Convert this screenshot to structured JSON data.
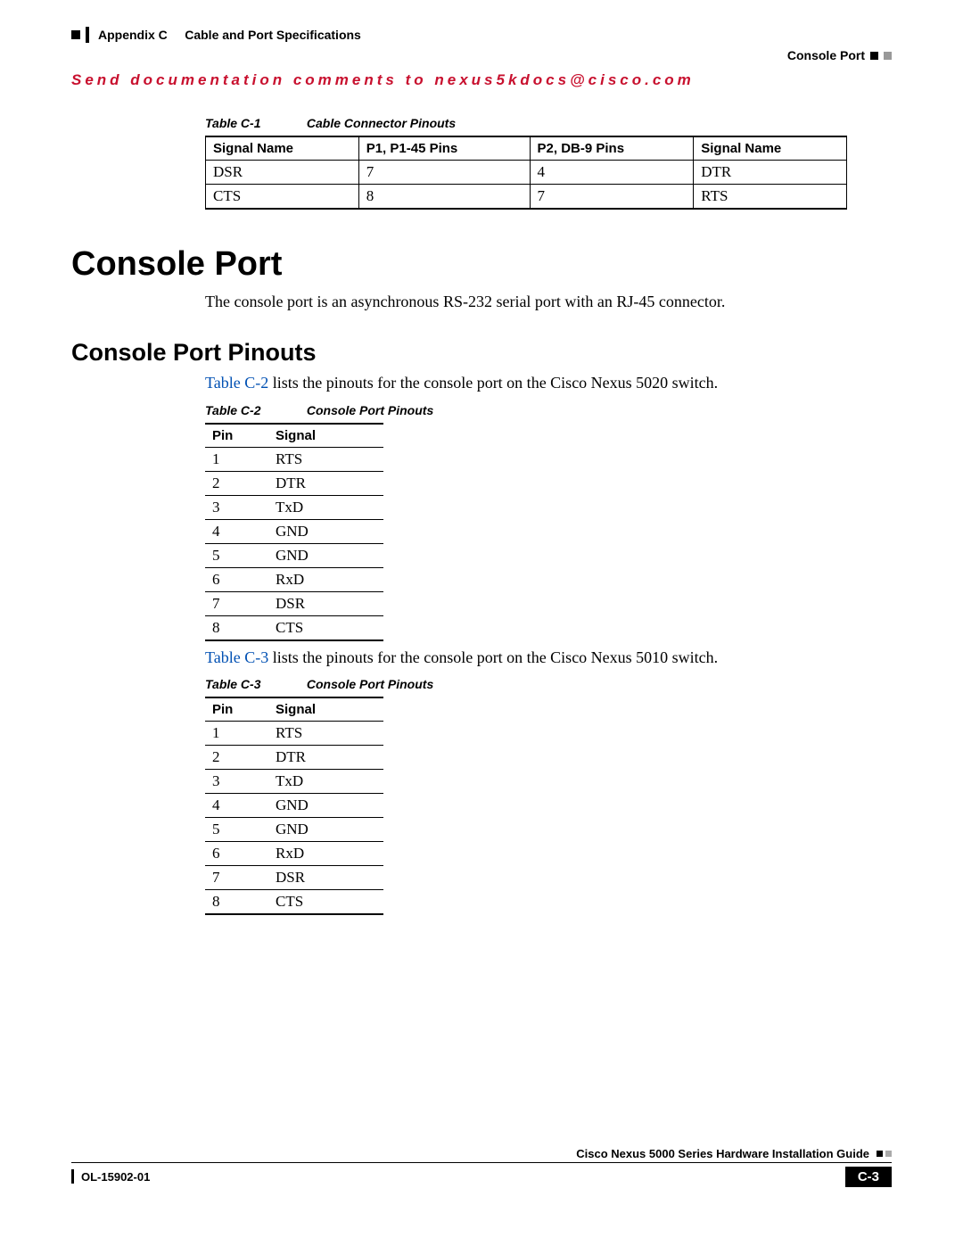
{
  "header": {
    "appendix": "Appendix C",
    "chapter": "Cable and Port Specifications",
    "section_label": "Console Port"
  },
  "send_comments": "Send documentation comments to nexus5kdocs@cisco.com",
  "table_c1": {
    "num": "Table C-1",
    "title": "Cable Connector Pinouts",
    "headers": [
      "Signal Name",
      "P1, P1-45 Pins",
      "P2, DB-9 Pins",
      "Signal Name"
    ],
    "rows": [
      [
        "DSR",
        "7",
        "4",
        "DTR"
      ],
      [
        "CTS",
        "8",
        "7",
        "RTS"
      ]
    ]
  },
  "h1_console_port": "Console Port",
  "p_console_port": "The console port is an asynchronous RS-232 serial port with an RJ-45 connector.",
  "h2_pinouts": "Console Port Pinouts",
  "p_c2_link": "Table C-2",
  "p_c2_rest": " lists the pinouts for the console port on the Cisco Nexus 5020 switch.",
  "table_c2": {
    "num": "Table C-2",
    "title": "Console Port Pinouts",
    "headers": [
      "Pin",
      "Signal"
    ],
    "rows": [
      [
        "1",
        "RTS"
      ],
      [
        "2",
        "DTR"
      ],
      [
        "3",
        "TxD"
      ],
      [
        "4",
        "GND"
      ],
      [
        "5",
        "GND"
      ],
      [
        "6",
        "RxD"
      ],
      [
        "7",
        "DSR"
      ],
      [
        "8",
        "CTS"
      ]
    ]
  },
  "p_c3_link": "Table C-3",
  "p_c3_rest": " lists the pinouts for the console port on the Cisco Nexus 5010 switch.",
  "table_c3": {
    "num": "Table C-3",
    "title": "Console Port Pinouts",
    "headers": [
      "Pin",
      "Signal"
    ],
    "rows": [
      [
        "1",
        "RTS"
      ],
      [
        "2",
        "DTR"
      ],
      [
        "3",
        "TxD"
      ],
      [
        "4",
        "GND"
      ],
      [
        "5",
        "GND"
      ],
      [
        "6",
        "RxD"
      ],
      [
        "7",
        "DSR"
      ],
      [
        "8",
        "CTS"
      ]
    ]
  },
  "footer": {
    "guide": "Cisco Nexus 5000 Series Hardware Installation Guide",
    "doc_num": "OL-15902-01",
    "page": "C-3"
  }
}
